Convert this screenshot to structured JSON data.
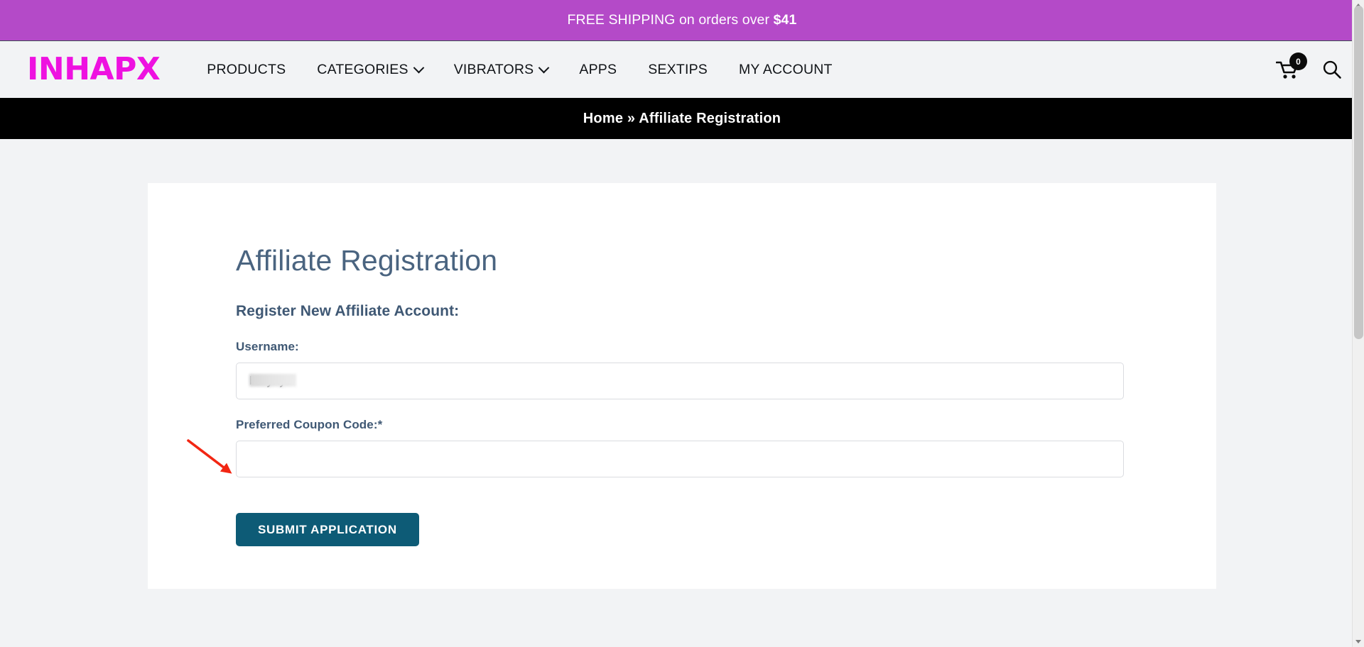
{
  "promo": {
    "prefix": "FREE SHIPPING on orders over ",
    "amount": "$41"
  },
  "header": {
    "logo": "INHAPX",
    "nav": [
      {
        "label": "PRODUCTS",
        "has_caret": false
      },
      {
        "label": "CATEGORIES",
        "has_caret": true
      },
      {
        "label": "VIBRATORS",
        "has_caret": true
      },
      {
        "label": "APPS",
        "has_caret": false
      },
      {
        "label": "SEXTIPS",
        "has_caret": false
      },
      {
        "label": "MY ACCOUNT",
        "has_caret": false
      }
    ],
    "cart_icon": "shopping-cart-icon",
    "cart_count": "0",
    "search_icon": "search-icon"
  },
  "breadcrumb": {
    "home": "Home",
    "separator": "»",
    "current": "Affiliate Registration",
    "full": "Home » Affiliate Registration"
  },
  "main": {
    "page_title": "Affiliate Registration",
    "section_title": "Register New Affiliate Account:",
    "fields": [
      {
        "label": "Username:",
        "value": "barynyz",
        "placeholder": "",
        "redacted": true
      },
      {
        "label": "Preferred Coupon Code:*",
        "value": "",
        "placeholder": "",
        "redacted": false
      }
    ],
    "submit_label": "SUBMIT APPLICATION"
  },
  "annotation": {
    "arrow_color": "#f22613",
    "points_to": "Preferred Coupon Code input"
  },
  "colors": {
    "promo_bg": "#b44ac8",
    "logo": "#ee11e0",
    "breadcrumb_bg": "#000000",
    "page_bg": "#f2f3f5",
    "heading": "#4a6480",
    "button": "#0d5b76"
  }
}
